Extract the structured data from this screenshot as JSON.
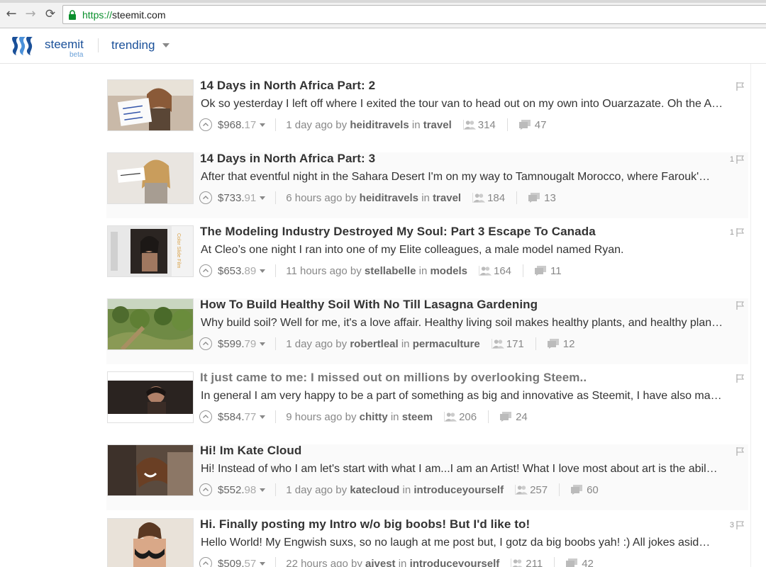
{
  "browser": {
    "url_scheme": "https://",
    "url_host": "steemit.com"
  },
  "header": {
    "brand": "steemit",
    "beta": "beta",
    "sort": "trending"
  },
  "colors": {
    "brand_blue": "#1a5099",
    "secure_green": "#0a8f2c"
  },
  "posts": [
    {
      "title": "14 Days in North Africa Part: 2",
      "excerpt": "Ok so yesterday I left off where I exited the tour van to head out on my own into Ouarzazate. Oh the A…",
      "payout_main": "$968.",
      "payout_cents": "17",
      "time": "1 day ago",
      "by": "by",
      "author": "heiditravels",
      "in": "in",
      "tag": "travel",
      "voters": "314",
      "comments": "47",
      "flag_count": ""
    },
    {
      "title": "14 Days in North Africa Part: 3",
      "excerpt": "After that eventful night in the Sahara Desert I'm on my way to Tamnougalt Morocco, where Farouk'…",
      "payout_main": "$733.",
      "payout_cents": "91",
      "time": "6 hours ago",
      "by": "by",
      "author": "heiditravels",
      "in": "in",
      "tag": "travel",
      "voters": "184",
      "comments": "13",
      "flag_count": "1"
    },
    {
      "title": "The Modeling Industry Destroyed My Soul: Part 3 Escape To Canada",
      "excerpt": "At Cleo’s one night I ran into one of my Elite colleagues, a male model named Ryan.",
      "payout_main": "$653.",
      "payout_cents": "89",
      "time": "11 hours ago",
      "by": "by",
      "author": "stellabelle",
      "in": "in",
      "tag": "models",
      "voters": "164",
      "comments": "11",
      "flag_count": "1"
    },
    {
      "title": "How To Build Healthy Soil With No Till Lasagna Gardening",
      "excerpt": "Why build soil? Well for me, it's a love affair. Healthy living soil makes healthy plants, and healthy plan…",
      "payout_main": "$599.",
      "payout_cents": "79",
      "time": "1 day ago",
      "by": "by",
      "author": "robertleal",
      "in": "in",
      "tag": "permaculture",
      "voters": "171",
      "comments": "12",
      "flag_count": ""
    },
    {
      "title": "It just came to me: I missed out on millions by overlooking Steem..",
      "excerpt": "In general I am very happy to be a part of something as big and innovative as Steemit, I have also ma…",
      "payout_main": "$584.",
      "payout_cents": "77",
      "time": "9 hours ago",
      "by": "by",
      "author": "chitty",
      "in": "in",
      "tag": "steem",
      "voters": "206",
      "comments": "24",
      "flag_count": ""
    },
    {
      "title": "Hi! Im Kate Cloud",
      "excerpt": "Hi! Instead of who I am let's start with what I am...I am an Artist! What I love most about art is the abil…",
      "payout_main": "$552.",
      "payout_cents": "98",
      "time": "1 day ago",
      "by": "by",
      "author": "katecloud",
      "in": "in",
      "tag": "introduceyourself",
      "voters": "257",
      "comments": "60",
      "flag_count": ""
    },
    {
      "title": "Hi. Finally posting my Intro w/o big boobs! But I'd like to!",
      "excerpt": "Hello World! My Engwish suxs, so no laugh at me post but, I gotz da big boobs yah! :) All jokes asid…",
      "payout_main": "$509.",
      "payout_cents": "57",
      "time": "22 hours ago",
      "by": "by",
      "author": "aivest",
      "in": "in",
      "tag": "introduceyourself",
      "voters": "211",
      "comments": "42",
      "flag_count": "3"
    }
  ]
}
